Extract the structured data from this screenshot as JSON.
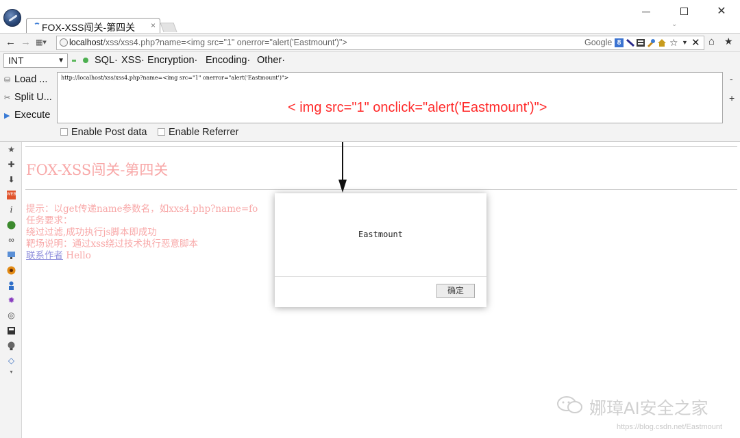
{
  "window": {
    "tab_title": "FOX-XSS闯关-第四关",
    "tab_close": "×",
    "close_glyph": "✕"
  },
  "navbar": {
    "url_host": "localhost",
    "url_path": "/xss/xss4.php?name=<img src=\"1\" onerror=\"alert('Eastmount')\">",
    "search_engine": "Google",
    "search_badge": "8"
  },
  "hackbar": {
    "select_value": "INT",
    "menus": [
      "SQL·",
      "XSS·",
      "Encryption·",
      "Encoding·",
      "Other·"
    ],
    "buttons": {
      "load": "Load ...",
      "split": "Split U...",
      "execute": "Execute"
    },
    "url_text": "http://localhost/xss/xss4.php?name=<img src=\"1\" onerror=\"alert('Eastmount')\">",
    "annotation": "< img src=\"1\" onclick=\"alert('Eastmount')\">",
    "enable_post": "Enable Post data",
    "enable_referrer": "Enable Referrer",
    "minus": "-",
    "plus": "+"
  },
  "page": {
    "title": "FOX-XSS闯关-第四关",
    "hint": "提示：以get传递name参数名，如xxs4.php?name=fo",
    "task": "任务要求：",
    "bypass": "绕过过滤,成功执行js脚本即成功",
    "range_note": "靶场说明：通过xss绕过技术执行恶意脚本",
    "contact_link": "联系作者",
    "hello": "Hello"
  },
  "alert": {
    "message": "Eastmount",
    "ok_label": "确定"
  },
  "watermark": {
    "text": "娜璋AI安全之家",
    "url": "https://blog.csdn.net/Eastmount"
  },
  "colors": {
    "annotation_red": "#ff2a2a",
    "page_pink": "#f8a8a8",
    "link_blue": "#8f8fdc"
  },
  "icons": {
    "sidebar": [
      "star-icon",
      "puzzle-icon",
      "download-icon",
      "web-developer-icon",
      "info-icon",
      "green-globe-icon",
      "glasses-icon",
      "monitor-icon",
      "firebug-icon",
      "figure-icon",
      "purple-gear-icon",
      "palette-icon",
      "calculator-icon",
      "lightbulb-icon",
      "brush-icon"
    ]
  }
}
